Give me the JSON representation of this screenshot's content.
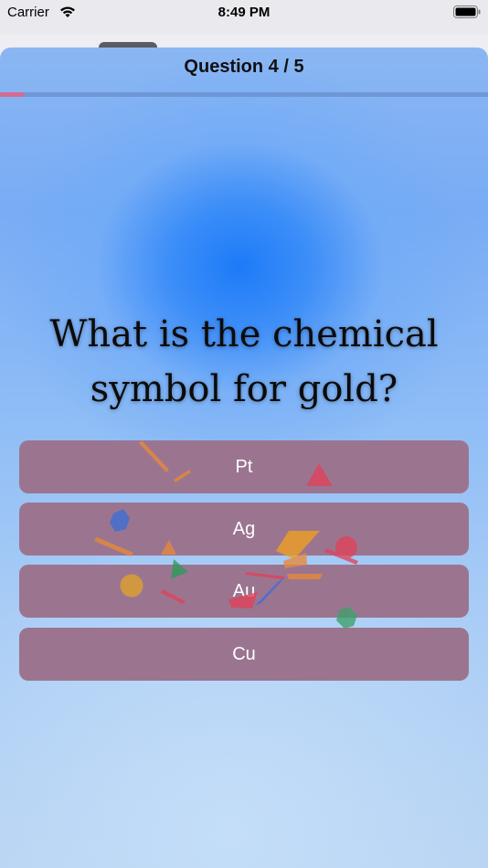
{
  "status_bar": {
    "carrier": "Carrier",
    "time": "8:49 PM"
  },
  "quiz": {
    "counter": "Question 4 / 5",
    "progress": 0.05,
    "question": "What is the chemical symbol for gold?",
    "answers": [
      {
        "label": "Pt"
      },
      {
        "label": "Ag"
      },
      {
        "label": "Au"
      },
      {
        "label": "Cu"
      }
    ]
  },
  "colors": {
    "progress_fill": "#d56b8f",
    "answer_button": "#9b7590"
  }
}
